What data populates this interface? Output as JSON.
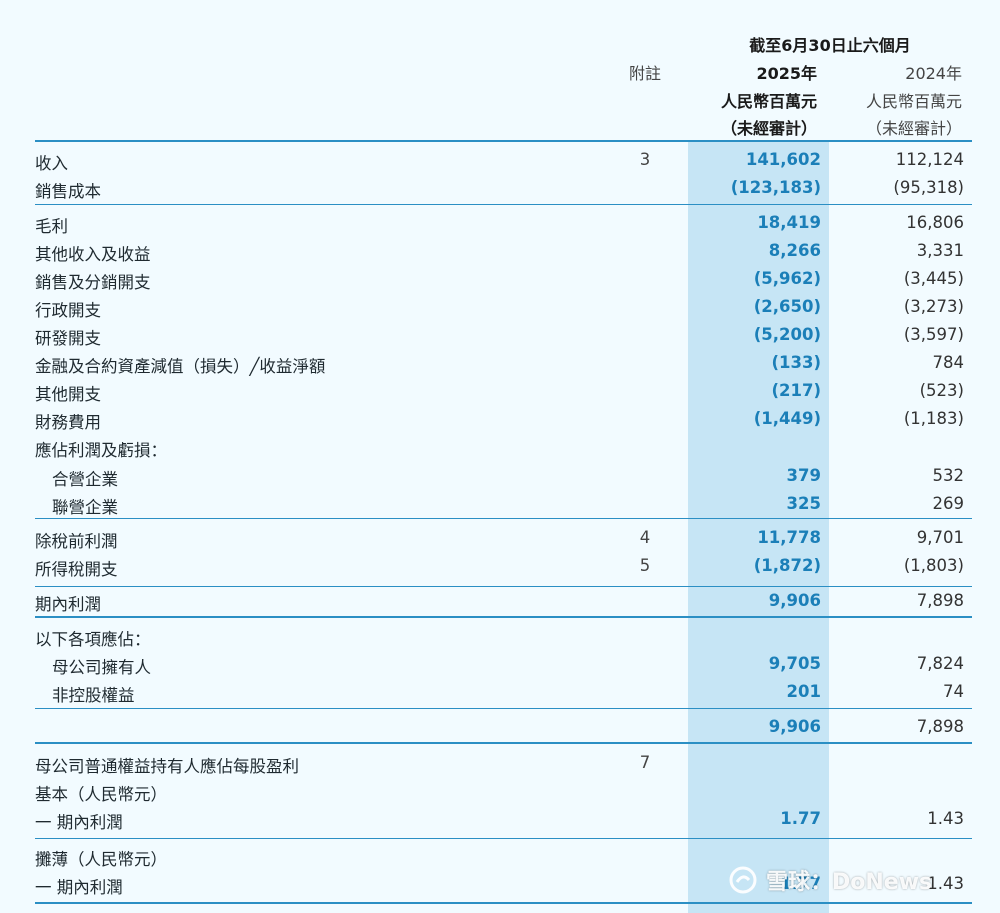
{
  "header": {
    "period": "截至6月30日止六個月",
    "note": "附註",
    "y2025": "2025年",
    "y2024": "2024年",
    "unit2025": "人民幣百萬元",
    "unit2024": "人民幣百萬元",
    "audit2025": "（未經審計）",
    "audit2024": "（未經審計）"
  },
  "rows": [
    {
      "label": "收入",
      "note": "3",
      "v2025": "141,602",
      "v2024": "112,124"
    },
    {
      "label": "銷售成本",
      "note": "",
      "v2025": "(123,183)",
      "v2024": "(95,318)"
    },
    {
      "label": "毛利",
      "note": "",
      "v2025": "18,419",
      "v2024": "16,806"
    },
    {
      "label": "其他收入及收益",
      "note": "",
      "v2025": "8,266",
      "v2024": "3,331"
    },
    {
      "label": "銷售及分銷開支",
      "note": "",
      "v2025": "(5,962)",
      "v2024": "(3,445)"
    },
    {
      "label": "行政開支",
      "note": "",
      "v2025": "(2,650)",
      "v2024": "(3,273)"
    },
    {
      "label": "研發開支",
      "note": "",
      "v2025": "(5,200)",
      "v2024": "(3,597)"
    },
    {
      "label": "金融及合約資產減值（損失）╱收益淨額",
      "note": "",
      "v2025": "(133)",
      "v2024": "784"
    },
    {
      "label": "其他開支",
      "note": "",
      "v2025": "(217)",
      "v2024": "(523)"
    },
    {
      "label": "財務費用",
      "note": "",
      "v2025": "(1,449)",
      "v2024": "(1,183)"
    },
    {
      "label": "應佔利潤及虧損：",
      "note": "",
      "v2025": "",
      "v2024": ""
    },
    {
      "label": "合營企業",
      "note": "",
      "v2025": "379",
      "v2024": "532"
    },
    {
      "label": "聯營企業",
      "note": "",
      "v2025": "325",
      "v2024": "269"
    },
    {
      "label": "除稅前利潤",
      "note": "4",
      "v2025": "11,778",
      "v2024": "9,701"
    },
    {
      "label": "所得稅開支",
      "note": "5",
      "v2025": "(1,872)",
      "v2024": "(1,803)"
    },
    {
      "label": "期內利潤",
      "note": "",
      "v2025": "9,906",
      "v2024": "7,898"
    },
    {
      "label": "以下各項應佔：",
      "note": "",
      "v2025": "",
      "v2024": ""
    },
    {
      "label": "母公司擁有人",
      "note": "",
      "v2025": "9,705",
      "v2024": "7,824"
    },
    {
      "label": "非控股權益",
      "note": "",
      "v2025": "201",
      "v2024": "74"
    },
    {
      "label": "",
      "note": "",
      "v2025": "9,906",
      "v2024": "7,898"
    },
    {
      "label": "母公司普通權益持有人應佔每股盈利",
      "note": "7",
      "v2025": "",
      "v2024": ""
    },
    {
      "label": "基本（人民幣元）",
      "note": "",
      "v2025": "",
      "v2024": ""
    },
    {
      "label": "一 期內利潤",
      "note": "",
      "v2025": "1.77",
      "v2024": "1.43"
    },
    {
      "label": "攤薄（人民幣元）",
      "note": "",
      "v2025": "",
      "v2024": ""
    },
    {
      "label": "一 期內利潤",
      "note": "",
      "v2025": "1.77",
      "v2024": "1.43"
    }
  ],
  "watermark": {
    "text": "雪球：DoNews",
    "icon": "snowball-logo-icon"
  },
  "colors": {
    "accent": "#2b8fc4",
    "highlight": "#c6e5f5",
    "value2025": "#1b7fb8",
    "background": "#f2fbff"
  }
}
